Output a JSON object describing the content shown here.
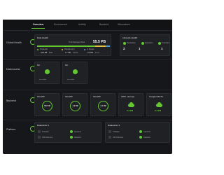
{
  "tabs": [
    {
      "label": "Overview",
      "active": true
    },
    {
      "label": "Environment",
      "active": false
    },
    {
      "label": "Activity",
      "active": false
    },
    {
      "label": "Backend",
      "active": false
    },
    {
      "label": "Alternatives",
      "active": false
    }
  ],
  "sections": {
    "global_health": "Global Health",
    "data_access": "Data Access",
    "backend": "Backend",
    "platform": "Platform"
  },
  "data_health": {
    "title": "Data Health",
    "total_label": "Total Managed Data",
    "total_value": "55.5 PB",
    "legend": [
      {
        "label": "Protected",
        "value": "44.5 PB",
        "pct": "80%",
        "color": "#64c832"
      },
      {
        "label": "Rebalancing",
        "value": "7.7 PB",
        "pct": "13.9%",
        "color": "#e0c040"
      },
      {
        "label": "In Repair",
        "value": "3.3 PB",
        "pct": "6.1%",
        "color": "#4aa0e0"
      }
    ],
    "fractions": [
      0.8,
      0.139,
      0.061
    ]
  },
  "lifecycle": {
    "title": "Lifecycle Health",
    "items": [
      {
        "label": "Replication",
        "value": "2"
      },
      {
        "label": "Expiration",
        "value": "1"
      },
      {
        "label": "Transition",
        "value": "1"
      }
    ]
  },
  "data_access": {
    "cards": [
      {
        "title": "S3",
        "caption": "accessible"
      },
      {
        "title": "S3",
        "caption": "accessible"
      }
    ]
  },
  "backend_cards": [
    {
      "title": "S3-ARC",
      "ring": "500 TB"
    },
    {
      "title": "S3-ARC",
      "ring": "4.9 PB"
    },
    {
      "title": "S3-ARC",
      "ring": "2.4 PB"
    },
    {
      "title": "AWS - Europe",
      "value": "3.2 PB"
    },
    {
      "title": "Google NA/US",
      "value": "2.3 PB"
    }
  ],
  "platform": {
    "datacenters": [
      {
        "title": "Datacenter 1",
        "items": [
          {
            "label": "5 Nodes"
          },
          {
            "label": "Services"
          },
          {
            "label": "340 Volumes"
          },
          {
            "label": "Network"
          }
        ]
      },
      {
        "title": "Datacenter 2",
        "items": [
          {
            "label": "5 Nodes"
          },
          {
            "label": "Services"
          },
          {
            "label": "340 Volumes"
          },
          {
            "label": "Network"
          }
        ]
      }
    ]
  },
  "colors": {
    "accent": "#64c832",
    "rebalancing": "#e0c040",
    "repair": "#4aa0e0",
    "background": "#16171a"
  }
}
